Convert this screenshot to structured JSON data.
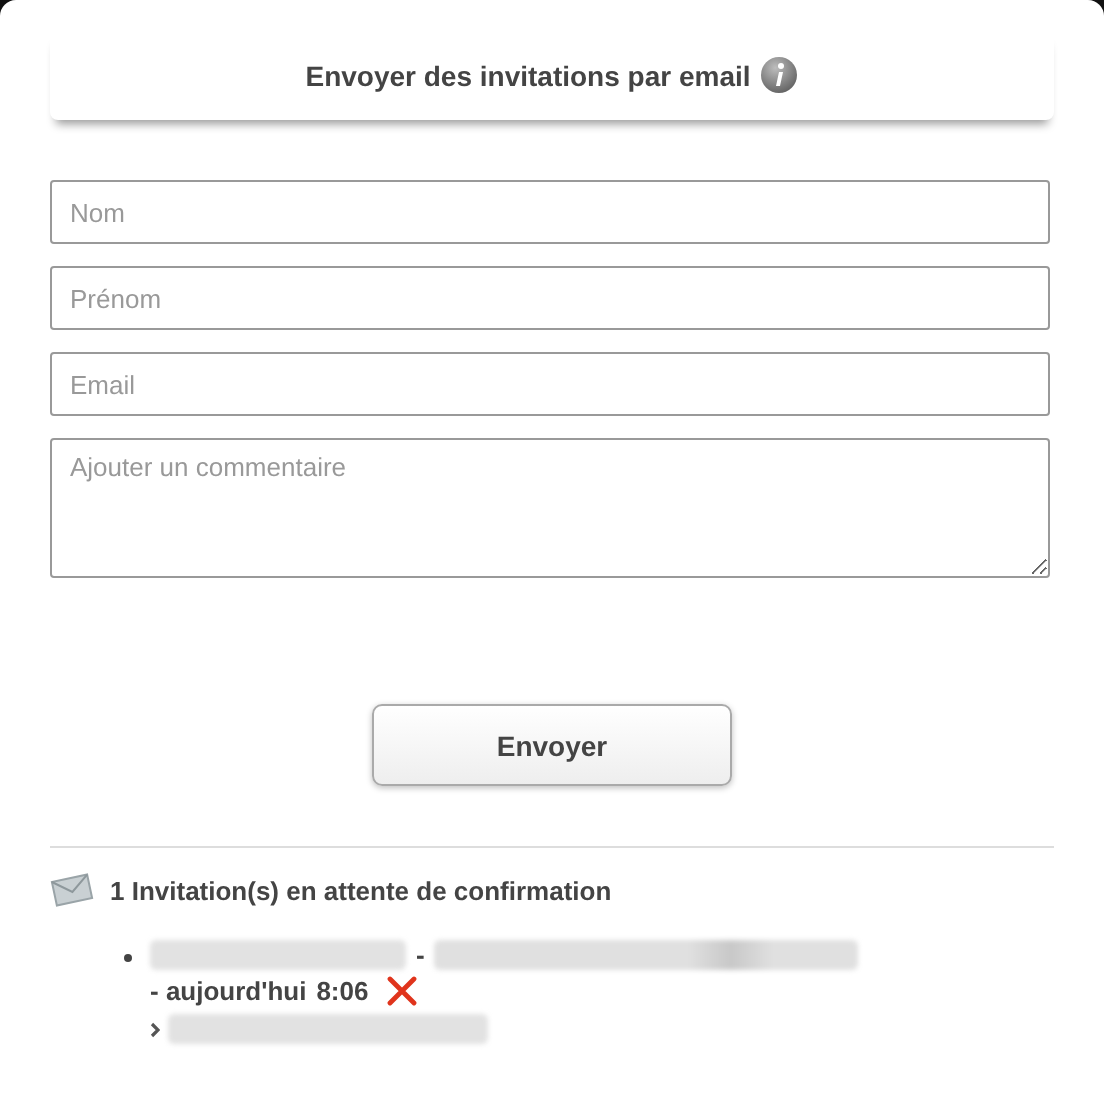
{
  "header": {
    "title": "Envoyer des invitations par email"
  },
  "fields": [
    {
      "kind": "input",
      "placeholder": "Nom"
    },
    {
      "kind": "input",
      "placeholder": "Prénom"
    },
    {
      "kind": "input",
      "placeholder": "Email"
    },
    {
      "kind": "textarea",
      "placeholder": "Ajouter un commentaire"
    }
  ],
  "submit": "Envoyer",
  "pending": {
    "heading": "1 Invitation(s) en attente de confirmation",
    "items": [
      {
        "separator_1": "-",
        "separator_2": "- aujourd'hui",
        "time": "8:06"
      }
    ]
  }
}
